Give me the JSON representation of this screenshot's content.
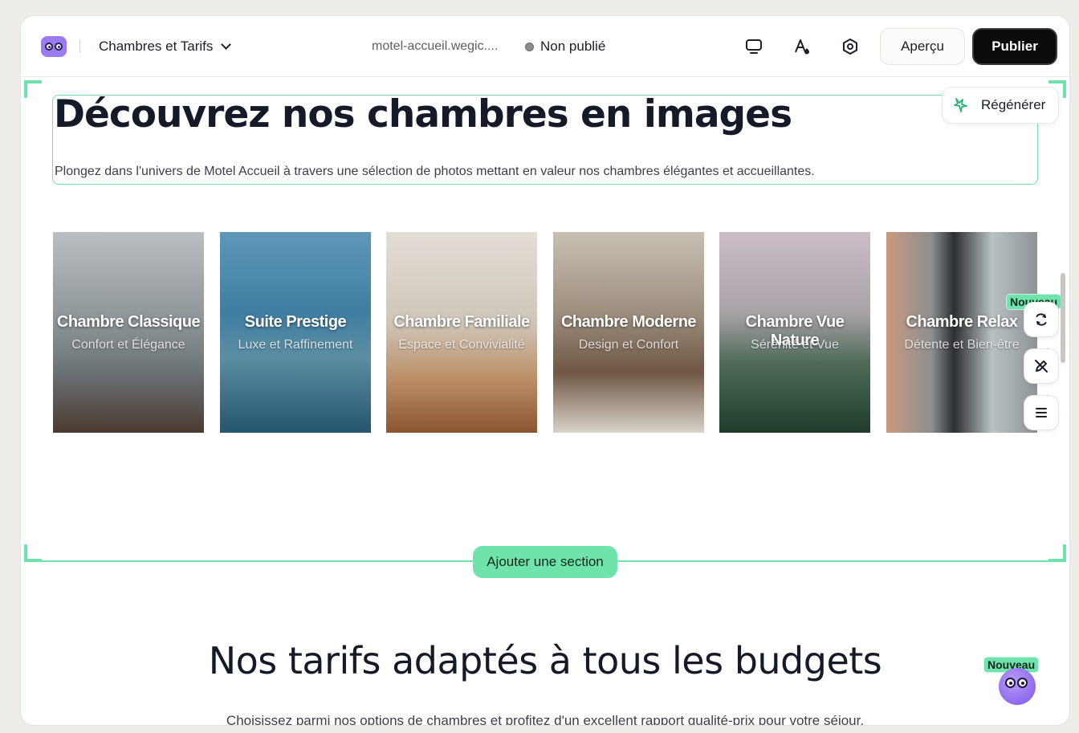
{
  "header": {
    "page_name": "Chambres et Tarifs",
    "domain": "motel-accueil.wegic....",
    "status": "Non publié",
    "preview_label": "Aperçu",
    "publish_label": "Publier"
  },
  "editor": {
    "regenerate_label": "Régénérer",
    "add_section_label": "Ajouter une section",
    "new_badge": "Nouveau"
  },
  "gallery_section": {
    "title": "Découvrez nos chambres en images",
    "lead": "Plongez dans l'univers de Motel Accueil à travers une sélection de photos mettant en valeur nos chambres élégantes et accueillantes.",
    "cards": [
      {
        "title": "Chambre Classique",
        "subtitle": "Confort et Élégance"
      },
      {
        "title": "Suite Prestige",
        "subtitle": "Luxe et Raffinement"
      },
      {
        "title": "Chambre Familiale",
        "subtitle": "Espace et Convivialité"
      },
      {
        "title": "Chambre Moderne",
        "subtitle": "Design et Confort"
      },
      {
        "title": "Chambre Vue Nature",
        "subtitle": "Sérénité et Vue"
      },
      {
        "title": "Chambre Relax",
        "subtitle": "Détente et Bien-être"
      }
    ]
  },
  "pricing_section": {
    "title": "Nos tarifs adaptés à tous les budgets",
    "lead": "Choisissez parmi nos options de chambres et profitez d'un excellent rapport qualité-prix pour votre séjour."
  },
  "colors": {
    "accent": "#6fe3ab",
    "publish": "#0b0b0c",
    "brand": "#9b7bf0"
  }
}
